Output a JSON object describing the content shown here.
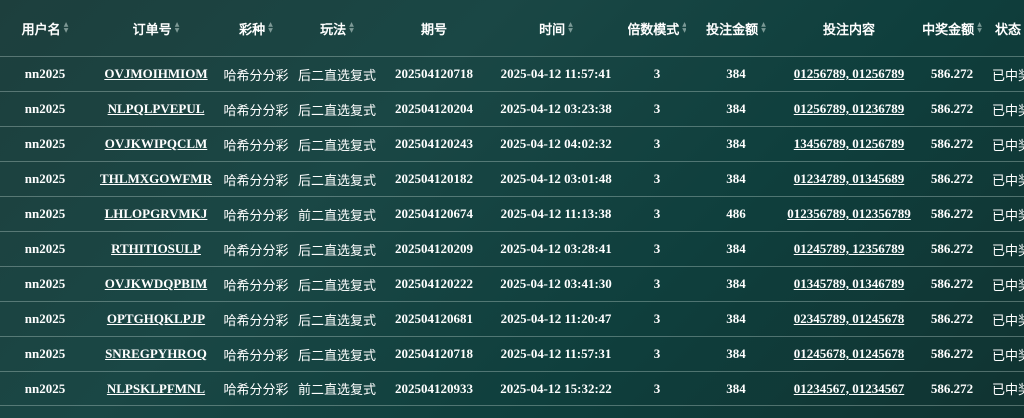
{
  "table": {
    "columns": [
      {
        "label": "用户名",
        "sortable": true
      },
      {
        "label": "订单号",
        "sortable": true
      },
      {
        "label": "彩种",
        "sortable": true
      },
      {
        "label": "玩法",
        "sortable": true
      },
      {
        "label": "期号",
        "sortable": false
      },
      {
        "label": "时间",
        "sortable": true
      },
      {
        "label": "倍数模式",
        "sortable": true
      },
      {
        "label": "投注金额",
        "sortable": true
      },
      {
        "label": "投注内容",
        "sortable": false
      },
      {
        "label": "中奖金额",
        "sortable": true
      },
      {
        "label": "状态",
        "sortable": false
      }
    ],
    "rows": [
      [
        "nn2025",
        "OVJMOIHMIOM",
        "哈希分分彩",
        "后二直选复式",
        "202504120718",
        "2025-04-12 11:57:41",
        "3",
        "384",
        "01256789, 01256789",
        "586.272",
        "已中奖"
      ],
      [
        "nn2025",
        "NLPQLPVEPUL",
        "哈希分分彩",
        "后二直选复式",
        "202504120204",
        "2025-04-12 03:23:38",
        "3",
        "384",
        "01256789, 01236789",
        "586.272",
        "已中奖"
      ],
      [
        "nn2025",
        "OVJKWIPQCLM",
        "哈希分分彩",
        "后二直选复式",
        "202504120243",
        "2025-04-12 04:02:32",
        "3",
        "384",
        "13456789, 01256789",
        "586.272",
        "已中奖"
      ],
      [
        "nn2025",
        "THLMXGOWFMR",
        "哈希分分彩",
        "后二直选复式",
        "202504120182",
        "2025-04-12 03:01:48",
        "3",
        "384",
        "01234789, 01345689",
        "586.272",
        "已中奖"
      ],
      [
        "nn2025",
        "LHLOPGRVMKJ",
        "哈希分分彩",
        "前二直选复式",
        "202504120674",
        "2025-04-12 11:13:38",
        "3",
        "486",
        "012356789, 012356789",
        "586.272",
        "已中奖"
      ],
      [
        "nn2025",
        "RTHITIOSULP",
        "哈希分分彩",
        "后二直选复式",
        "202504120209",
        "2025-04-12 03:28:41",
        "3",
        "384",
        "01245789, 12356789",
        "586.272",
        "已中奖"
      ],
      [
        "nn2025",
        "OVJKWDQPBIM",
        "哈希分分彩",
        "后二直选复式",
        "202504120222",
        "2025-04-12 03:41:30",
        "3",
        "384",
        "01345789, 01346789",
        "586.272",
        "已中奖"
      ],
      [
        "nn2025",
        "OPTGHQKLPJP",
        "哈希分分彩",
        "后二直选复式",
        "202504120681",
        "2025-04-12 11:20:47",
        "3",
        "384",
        "02345789, 01245678",
        "586.272",
        "已中奖"
      ],
      [
        "nn2025",
        "SNREGPYHROQ",
        "哈希分分彩",
        "后二直选复式",
        "202504120718",
        "2025-04-12 11:57:31",
        "3",
        "384",
        "01245678, 01245678",
        "586.272",
        "已中奖"
      ],
      [
        "nn2025",
        "NLPSKLPFMNL",
        "哈希分分彩",
        "前二直选复式",
        "202504120933",
        "2025-04-12 15:32:22",
        "3",
        "384",
        "01234567, 01234567",
        "586.272",
        "已中奖"
      ]
    ]
  }
}
